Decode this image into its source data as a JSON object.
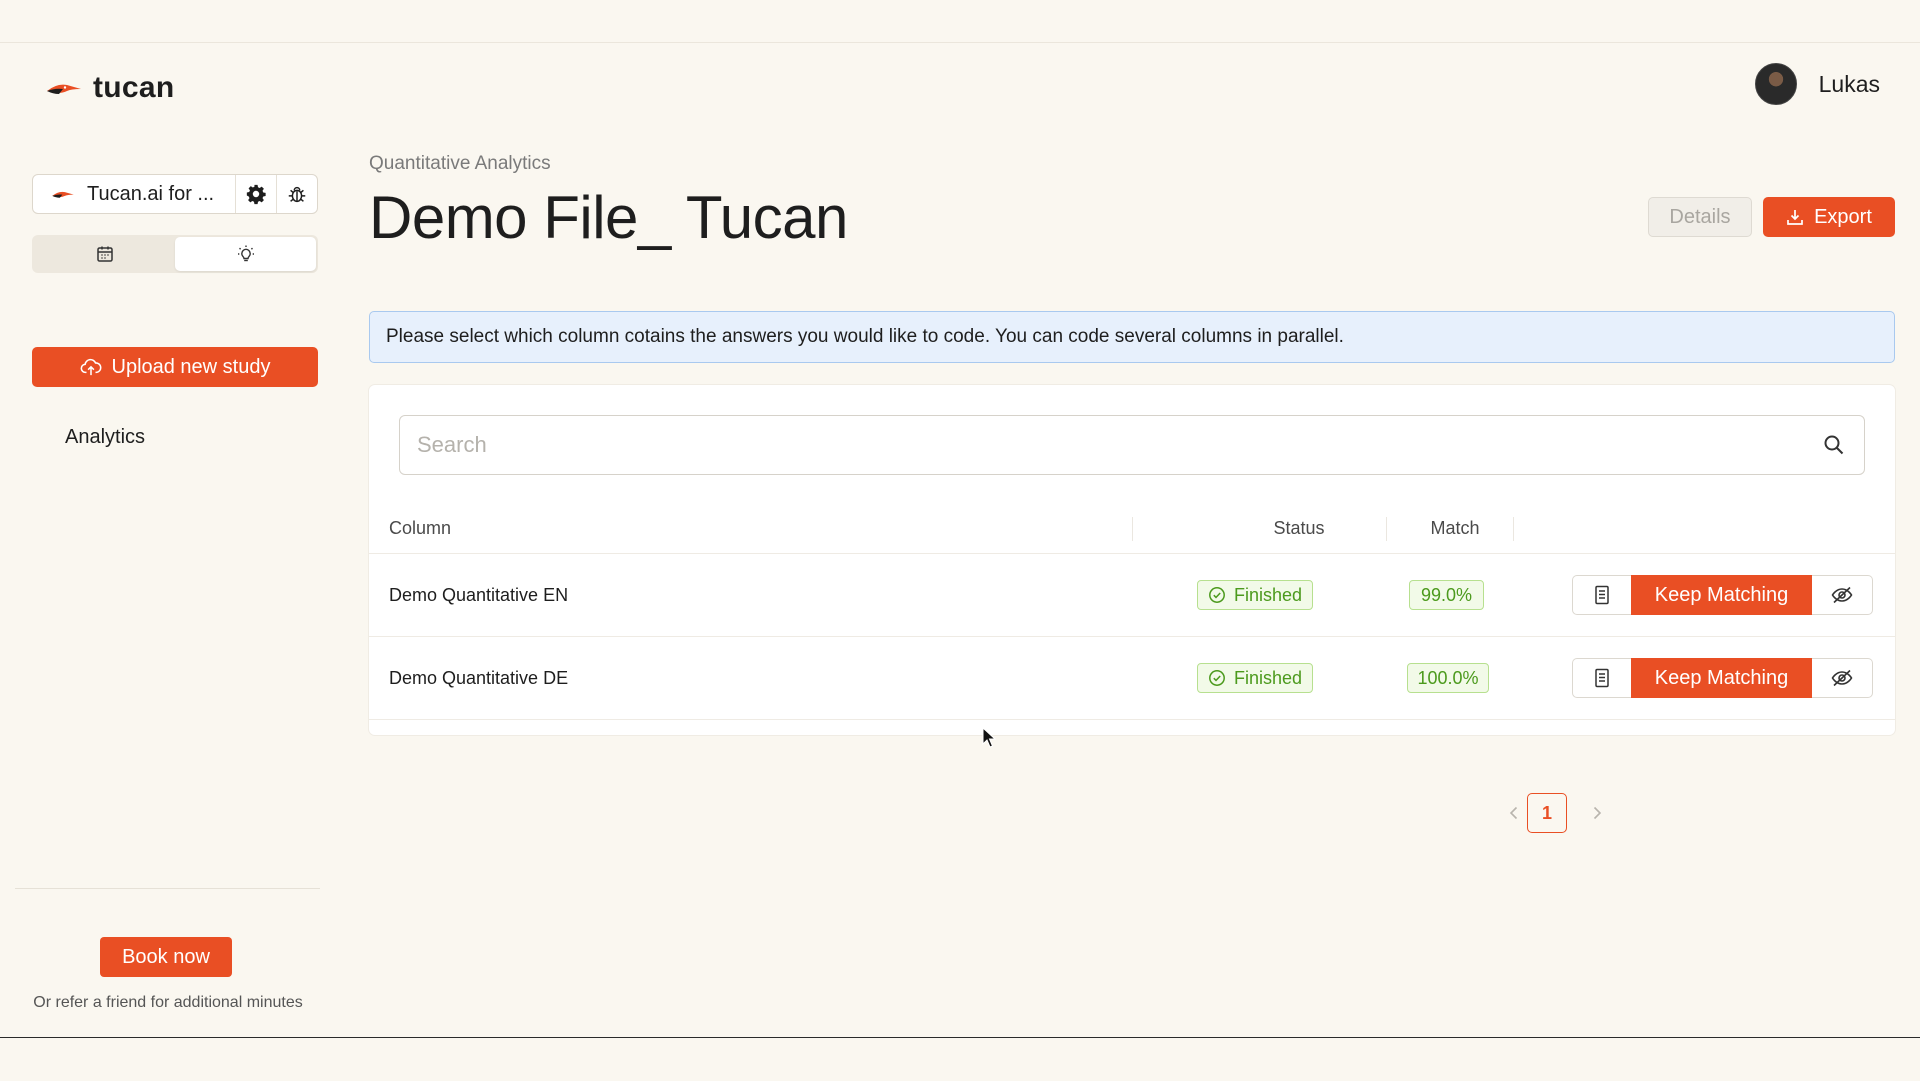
{
  "app": {
    "name": "tucan",
    "brand_color": "#e94f24"
  },
  "user": {
    "name": "Lukas"
  },
  "sidebar": {
    "workspace_label": "Tucan.ai for ...",
    "upload_label": "Upload new study",
    "nav": [
      {
        "label": "Analytics"
      }
    ],
    "book_label": "Book now",
    "refer_text": "Or refer a friend for additional minutes"
  },
  "page": {
    "breadcrumb": "Quantitative Analytics",
    "title": "Demo File_ Tucan",
    "details_label": "Details",
    "export_label": "Export",
    "banner": "Please select which column cotains the answers you would like to code. You can code several columns in parallel."
  },
  "search": {
    "placeholder": "Search",
    "value": ""
  },
  "table": {
    "headers": {
      "column": "Column",
      "status": "Status",
      "match": "Match"
    },
    "rows": [
      {
        "column": "Demo Quantitative EN",
        "status": "Finished",
        "match": "99.0%",
        "action": "Keep Matching"
      },
      {
        "column": "Demo Quantitative DE",
        "status": "Finished",
        "match": "100.0%",
        "action": "Keep Matching"
      }
    ]
  },
  "pagination": {
    "current": "1"
  }
}
